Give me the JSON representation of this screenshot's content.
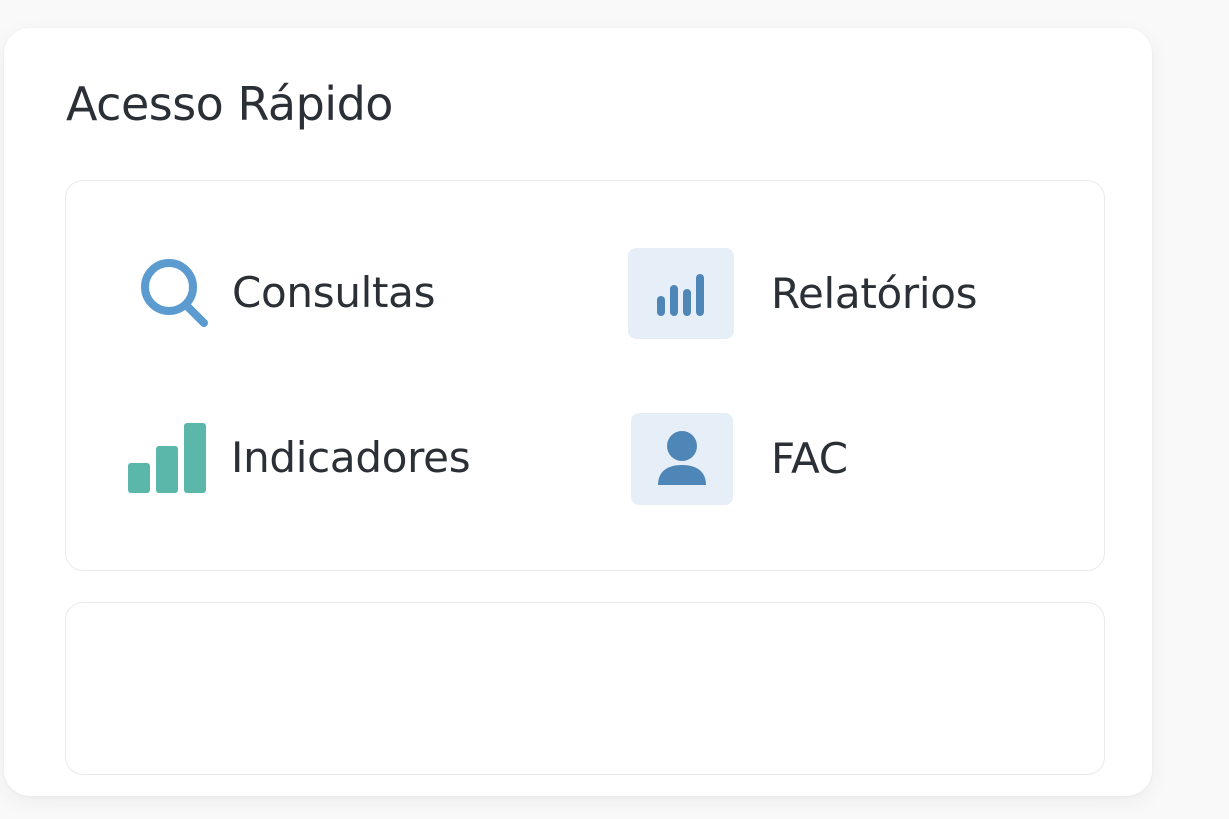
{
  "quick_access": {
    "title": "Acesso Rápido",
    "links": [
      {
        "label": "Consultas",
        "icon": "search-icon"
      },
      {
        "label": "Relatórios",
        "icon": "bar-chart-icon"
      },
      {
        "label": "Indicadores",
        "icon": "indicators-icon"
      },
      {
        "label": "FAC",
        "icon": "user-icon"
      }
    ]
  },
  "colors": {
    "search_blue": "#5b9bd0",
    "chart_blue": "#4f86b8",
    "teal": "#5bb7a9",
    "tile_bg": "#e6eef8",
    "text": "#2b2f36"
  }
}
